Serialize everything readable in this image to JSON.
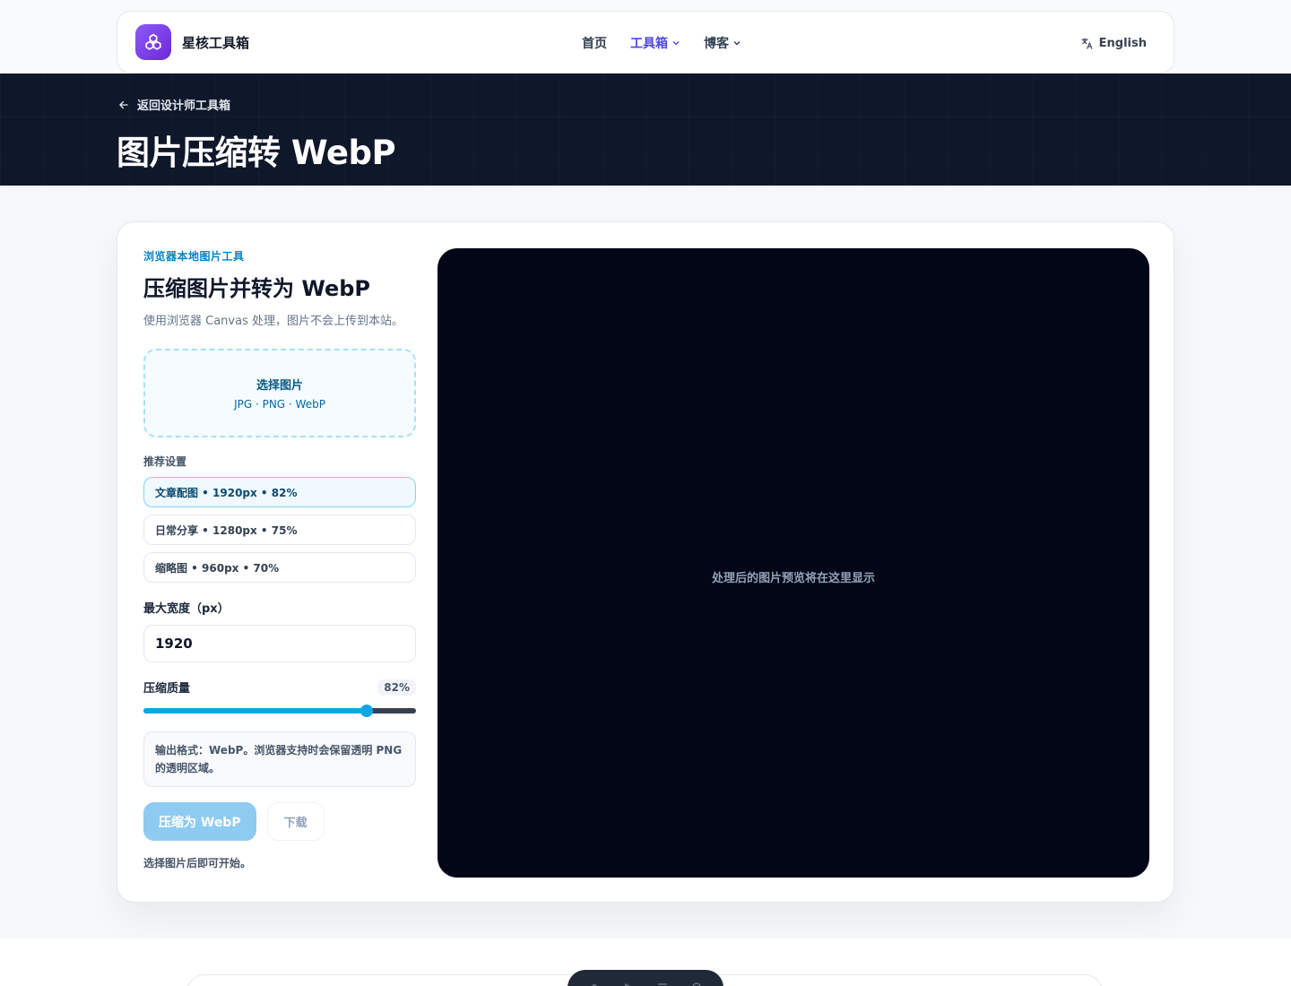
{
  "header": {
    "brand": "星核工具箱",
    "nav": [
      {
        "label": "首页"
      },
      {
        "label": "工具箱"
      },
      {
        "label": "博客"
      }
    ],
    "language": "English"
  },
  "hero": {
    "back_label": "返回设计师工具箱",
    "title": "图片压缩转 WebP"
  },
  "panel": {
    "eyebrow": "浏览器本地图片工具",
    "title": "压缩图片并转为 WebP",
    "description": "使用浏览器 Canvas 处理，图片不会上传到本站。",
    "dropzone": {
      "title": "选择图片",
      "formats": "JPG · PNG · WebP"
    },
    "presets_label": "推荐设置",
    "presets": [
      {
        "label": "文章配图 • 1920px • 82%"
      },
      {
        "label": "日常分享 • 1280px • 75%"
      },
      {
        "label": "缩略图 • 960px • 70%"
      }
    ],
    "max_width_label": "最大宽度（px）",
    "max_width_value": "1920",
    "quality_label": "压缩质量",
    "quality_display": "82%",
    "quality_value": 0.82,
    "note": "输出格式：WebP。浏览器支持时会保留透明 PNG 的透明区域。",
    "compress_button": "压缩为 WebP",
    "download_button": "下载",
    "hint": "选择图片后即可开始。"
  },
  "preview": {
    "placeholder": "处理后的图片预览将在这里显示"
  },
  "colors": {
    "accent": "#0ea5e9",
    "brand": "#7c3aed",
    "hero_bg": "#0f172a",
    "preview_bg": "#020617"
  }
}
